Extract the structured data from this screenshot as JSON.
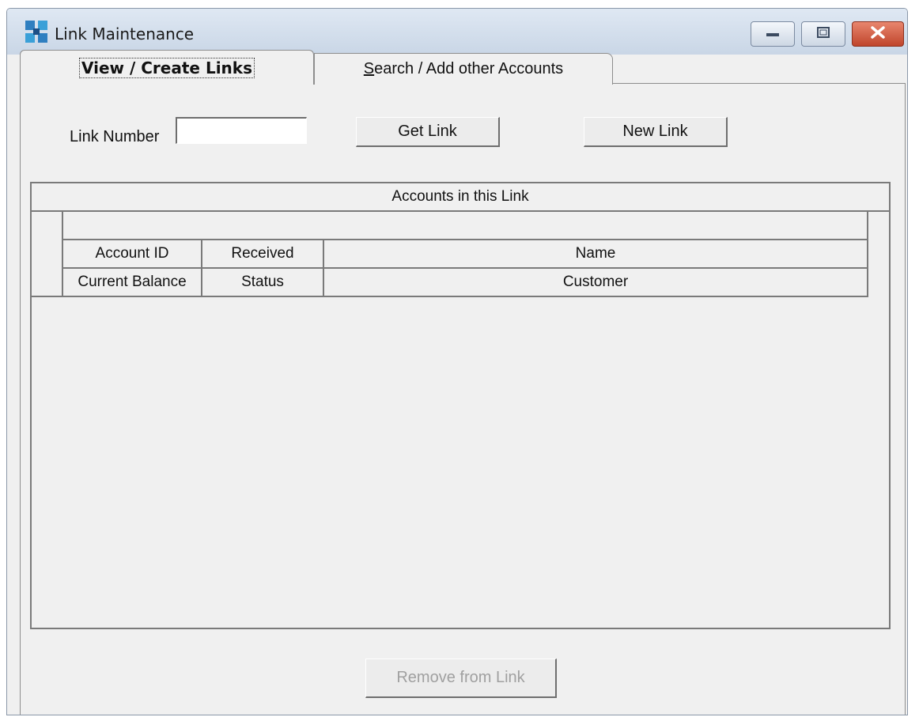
{
  "window": {
    "title": "Link Maintenance",
    "icon": "network-grid-icon",
    "controls": [
      "minimize-icon",
      "maximize-icon",
      "close-icon"
    ]
  },
  "tabs": [
    {
      "label": "View / Create Links",
      "active": true
    },
    {
      "label_mnemonic": "S",
      "label_rest": "earch / Add other Accounts",
      "active": false
    }
  ],
  "form": {
    "link_number_label": "Link Number",
    "link_number_value": "",
    "get_link_label": "Get Link",
    "new_link_label": "New Link"
  },
  "grid": {
    "caption": "Accounts in this Link",
    "header_row1": [
      "Account ID",
      "Received",
      "Name"
    ],
    "header_row2": [
      "Current Balance",
      "Status",
      "Customer"
    ],
    "rows": []
  },
  "footer": {
    "remove_label": "Remove from Link",
    "remove_enabled": false
  },
  "colors": {
    "title_bar": "#c9d6e6",
    "close_button": "#c0452c",
    "panel_background": "#f0f0f0"
  }
}
